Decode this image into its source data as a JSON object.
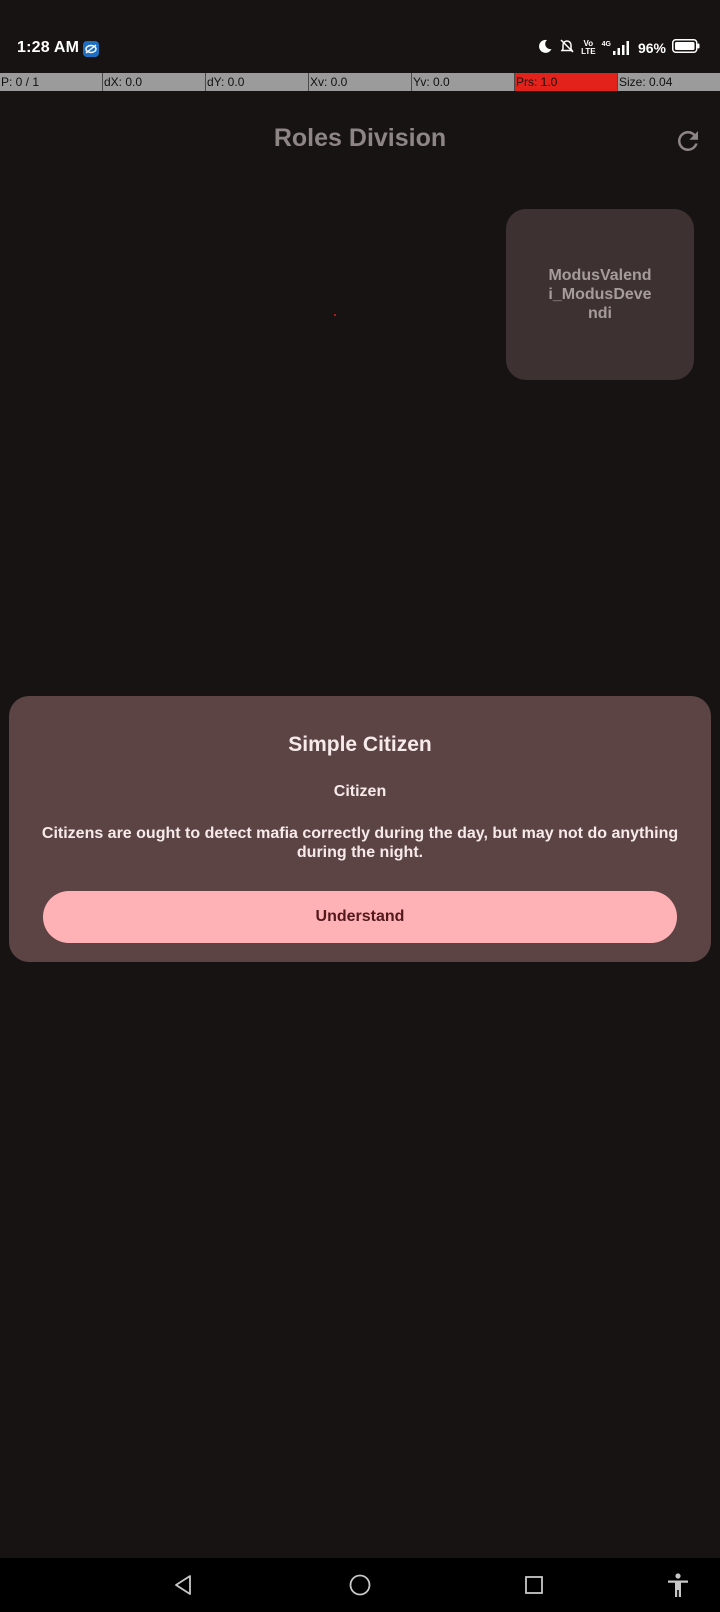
{
  "status_bar": {
    "time": "1:28 AM",
    "battery": "96%",
    "vo_lte_top": "Vo",
    "vo_lte_bottom": "LTE",
    "network": "4G"
  },
  "pointer_bar": {
    "cells": [
      "P: 0 / 1",
      "dX: 0.0",
      "dY: 0.0",
      "Xv: 0.0",
      "Yv: 0.0",
      "Prs: 1.0",
      "Size: 0.04"
    ]
  },
  "header": {
    "title": "Roles Division"
  },
  "player_card": {
    "name": "ModusValendi_ModusDevendi"
  },
  "dialog": {
    "title": "Simple Citizen",
    "subtitle": "Citizen",
    "description": "Citizens are ought to detect mafia correctly during the day, but may not do anything during the night.",
    "button_label": "Understand"
  },
  "icons": {
    "refresh": "refresh-icon",
    "back": "back-triangle-icon",
    "home": "home-circle-icon",
    "recents": "recents-square-icon",
    "accessibility": "accessibility-icon"
  },
  "colors": {
    "background": "#161312",
    "dialog": "#5c4344",
    "button": "#ffb2b6",
    "card": "#3e3132",
    "pressure_alert": "#e3231b"
  }
}
